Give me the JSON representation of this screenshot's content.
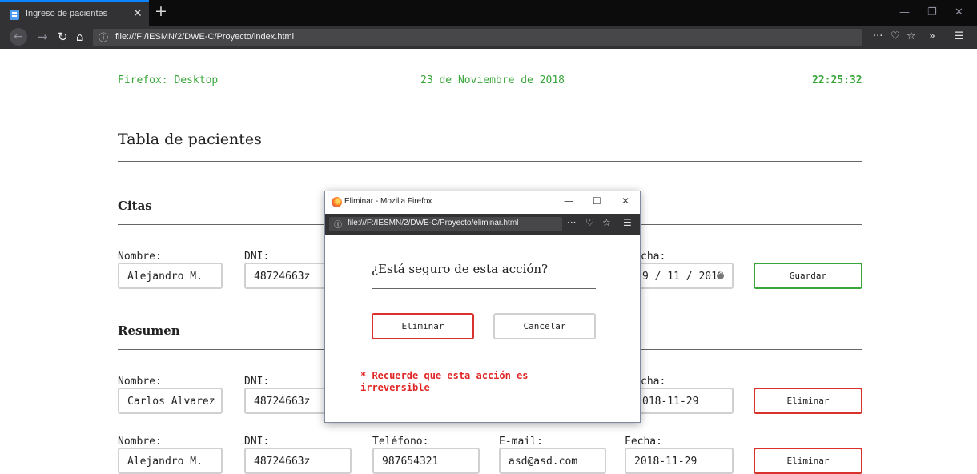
{
  "browser": {
    "tab_title": "Ingreso de pacientes",
    "url": "file:///F:/IESMN/2/DWE-C/Proyecto/index.html"
  },
  "header": {
    "browser_info": "Firefox: Desktop",
    "date": "23 de Noviembre de 2018",
    "time": "22:25:32"
  },
  "page_title": "Tabla de pacientes",
  "citas": {
    "title": "Citas",
    "labels": {
      "nombre": "Nombre:",
      "dni": "DNI:",
      "fecha": "cha:"
    },
    "values": {
      "nombre": "Alejandro M.",
      "dni": "48724663z",
      "fecha": "9 / 11 / 2018"
    },
    "save_label": "Guardar"
  },
  "resumen": {
    "title": "Resumen",
    "rows": [
      {
        "labels": {
          "nombre": "Nombre:",
          "dni": "DNI:",
          "fecha": "cha:"
        },
        "nombre": "Carlos Alvarez",
        "dni": "48724663z",
        "fecha": "018-11-29",
        "delete_label": "Eliminar"
      },
      {
        "labels": {
          "nombre": "Nombre:",
          "dni": "DNI:",
          "telefono": "Teléfono:",
          "email": "E-mail:",
          "fecha": "Fecha:"
        },
        "nombre": "Alejandro M.",
        "dni": "48724663z",
        "telefono": "987654321",
        "email": "asd@asd.com",
        "fecha": "2018-11-29",
        "delete_label": "Eliminar"
      }
    ]
  },
  "popup": {
    "window_title": "Eliminar - Mozilla Firefox",
    "url": "file:///F:/IESMN/2/DWE-C/Proyecto/eliminar.html",
    "question": "¿Está seguro de esta acción?",
    "delete_label": "Eliminar",
    "cancel_label": "Cancelar",
    "warning": "* Recuerde que esta acción es irreversible"
  },
  "colors": {
    "accent_green": "#3aa63a",
    "danger_red": "#d9312b",
    "chrome_dark": "#323234"
  }
}
